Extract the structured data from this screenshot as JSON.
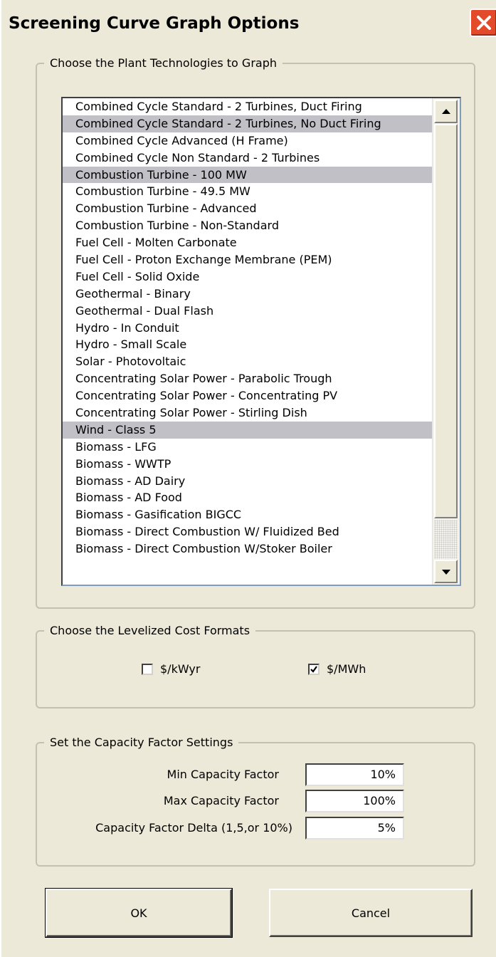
{
  "window": {
    "title": "Screening Curve Graph Options"
  },
  "technologies": {
    "legend": "Choose the Plant Technologies to Graph",
    "items": [
      {
        "label": "Combined Cycle Standard - 2 Turbines, Duct Firing",
        "selected": false
      },
      {
        "label": "Combined Cycle Standard - 2 Turbines, No Duct Firing",
        "selected": true
      },
      {
        "label": "Combined Cycle Advanced (H Frame)",
        "selected": false
      },
      {
        "label": "Combined Cycle Non Standard - 2 Turbines",
        "selected": false
      },
      {
        "label": "Combustion Turbine - 100 MW",
        "selected": true
      },
      {
        "label": "Combustion Turbine - 49.5 MW",
        "selected": false
      },
      {
        "label": "Combustion Turbine - Advanced",
        "selected": false
      },
      {
        "label": "Combustion Turbine - Non-Standard",
        "selected": false
      },
      {
        "label": "Fuel Cell - Molten Carbonate",
        "selected": false
      },
      {
        "label": "Fuel Cell -  Proton Exchange  Membrane (PEM)",
        "selected": false
      },
      {
        "label": "Fuel Cell - Solid Oxide",
        "selected": false
      },
      {
        "label": "Geothermal - Binary",
        "selected": false
      },
      {
        "label": "Geothermal - Dual Flash",
        "selected": false
      },
      {
        "label": "Hydro - In Conduit",
        "selected": false
      },
      {
        "label": "Hydro - Small Scale",
        "selected": false
      },
      {
        "label": "Solar - Photovoltaic",
        "selected": false
      },
      {
        "label": "Concentrating Solar Power - Parabolic Trough",
        "selected": false
      },
      {
        "label": "Concentrating Solar Power - Concentrating PV",
        "selected": false
      },
      {
        "label": "Concentrating Solar Power - Stirling Dish",
        "selected": false
      },
      {
        "label": "Wind - Class 5",
        "selected": true
      },
      {
        "label": "Biomass - LFG",
        "selected": false
      },
      {
        "label": "Biomass - WWTP",
        "selected": false
      },
      {
        "label": "Biomass - AD Dairy",
        "selected": false
      },
      {
        "label": "Biomass - AD Food",
        "selected": false
      },
      {
        "label": "Biomass - Gasification BIGCC",
        "selected": false
      },
      {
        "label": "Biomass - Direct Combustion W/ Fluidized Bed",
        "selected": false
      },
      {
        "label": "Biomass - Direct Combustion W/Stoker Boiler",
        "selected": false
      }
    ]
  },
  "cost_formats": {
    "legend": "Choose the Levelized Cost Formats",
    "kwyr": {
      "label": "$/kWyr",
      "checked": false
    },
    "mwh": {
      "label": "$/MWh",
      "checked": true
    }
  },
  "capacity": {
    "legend": "Set the Capacity Factor Settings",
    "min": {
      "label": "Min Capacity Factor",
      "value": "10%"
    },
    "max": {
      "label": "Max Capacity Factor",
      "value": "100%"
    },
    "delta": {
      "label": "Capacity Factor Delta (1,5,or 10%)",
      "value": "5%"
    }
  },
  "buttons": {
    "ok": "OK",
    "cancel": "Cancel"
  },
  "colors": {
    "selection": "#c0c0c6",
    "dialog_bg": "#ece9d8",
    "close_button": "#e24a2a"
  }
}
